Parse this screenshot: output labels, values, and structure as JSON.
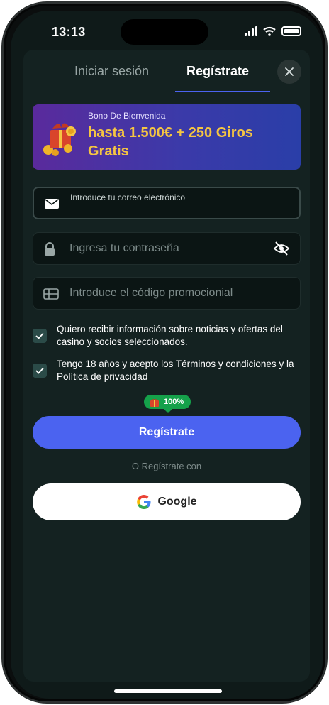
{
  "status_bar": {
    "time": "13:13"
  },
  "tabs": {
    "login": "Iniciar sesión",
    "register": "Regístrate"
  },
  "bonus": {
    "subtitle": "Bono De Bienvenida",
    "title": "hasta 1.500€ + 250 Giros Gratis",
    "icon": "gift-coins-icon"
  },
  "form": {
    "email_label": "Introduce tu correo electrónico",
    "password_placeholder": "Ingresa tu contraseña",
    "promo_placeholder": "Introduce el código promocionial"
  },
  "consents": {
    "marketing": "Quiero recibir información sobre noticias y ofertas del casino y socios seleccionados.",
    "terms_prefix": "Tengo 18 años y acepto los ",
    "terms_link": "Términos y condiciones",
    "terms_middle": " y la ",
    "privacy_link": "Política de privacidad"
  },
  "progress_badge": {
    "text": "100%",
    "value": 1.0
  },
  "register_button": "Regístrate",
  "divider_text": "O Regístrate con",
  "google_button": "Google",
  "colors": {
    "accent": "#4b63f0",
    "badge": "#15a14a",
    "bonus_text": "#f5c542",
    "background": "#0f1a19"
  }
}
